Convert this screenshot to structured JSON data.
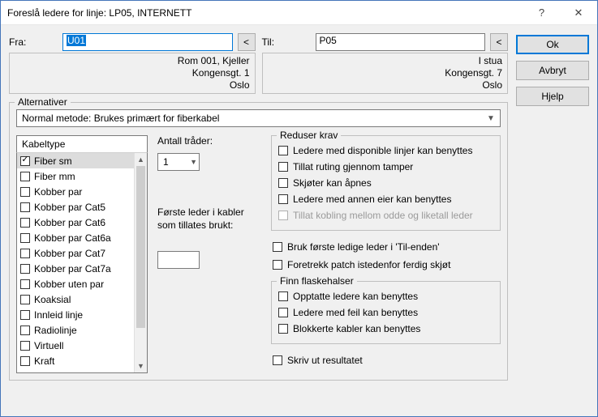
{
  "title": "Foreslå ledere for linje: LP05, INTERNETT",
  "buttons": {
    "ok": "Ok",
    "cancel": "Avbryt",
    "help": "Hjelp"
  },
  "from": {
    "label": "Fra:",
    "value": "U01",
    "browse": "<",
    "addr1": "Rom 001, Kjeller",
    "addr2": "Kongensgt. 1",
    "addr3": "Oslo"
  },
  "to": {
    "label": "Til:",
    "value": "P05",
    "browse": "<",
    "addr1": "I stua",
    "addr2": "Kongensgt. 7",
    "addr3": "Oslo"
  },
  "alt": {
    "legend": "Alternativer",
    "method": "Normal metode: Brukes primært for fiberkabel"
  },
  "cabletype": {
    "header": "Kabeltype",
    "items": [
      {
        "label": "Fiber sm",
        "checked": true,
        "selected": true
      },
      {
        "label": "Fiber mm",
        "checked": false
      },
      {
        "label": "Kobber par",
        "checked": false
      },
      {
        "label": "Kobber par Cat5",
        "checked": false
      },
      {
        "label": "Kobber par Cat6",
        "checked": false
      },
      {
        "label": "Kobber par Cat6a",
        "checked": false
      },
      {
        "label": "Kobber par Cat7",
        "checked": false
      },
      {
        "label": "Kobber par Cat7a",
        "checked": false
      },
      {
        "label": "Kobber uten par",
        "checked": false
      },
      {
        "label": "Koaksial",
        "checked": false
      },
      {
        "label": "Innleid linje",
        "checked": false
      },
      {
        "label": "Radiolinje",
        "checked": false
      },
      {
        "label": "Virtuell",
        "checked": false
      },
      {
        "label": "Kraft",
        "checked": false
      }
    ]
  },
  "threads": {
    "label": "Antall tråder:",
    "value": "1"
  },
  "firstLeader": {
    "label": "Første leder i kabler som tillates brukt:",
    "value": ""
  },
  "reduce": {
    "legend": "Reduser krav",
    "c1": "Ledere med disponible linjer kan benyttes",
    "c2": "Tillat ruting gjennom tamper",
    "c3": "Skjøter kan åpnes",
    "c4": "Ledere med annen eier kan benyttes",
    "c5": "Tillat kobling mellom odde og liketall leder"
  },
  "middle": {
    "m1": "Bruk første ledige leder i 'Til-enden'",
    "m2": "Foretrekk patch istedenfor ferdig skjøt"
  },
  "bottleneck": {
    "legend": "Finn flaskehalser",
    "b1": "Opptatte ledere kan benyttes",
    "b2": "Ledere med feil kan benyttes",
    "b3": "Blokkerte kabler kan benyttes"
  },
  "print": "Skriv ut resultatet"
}
